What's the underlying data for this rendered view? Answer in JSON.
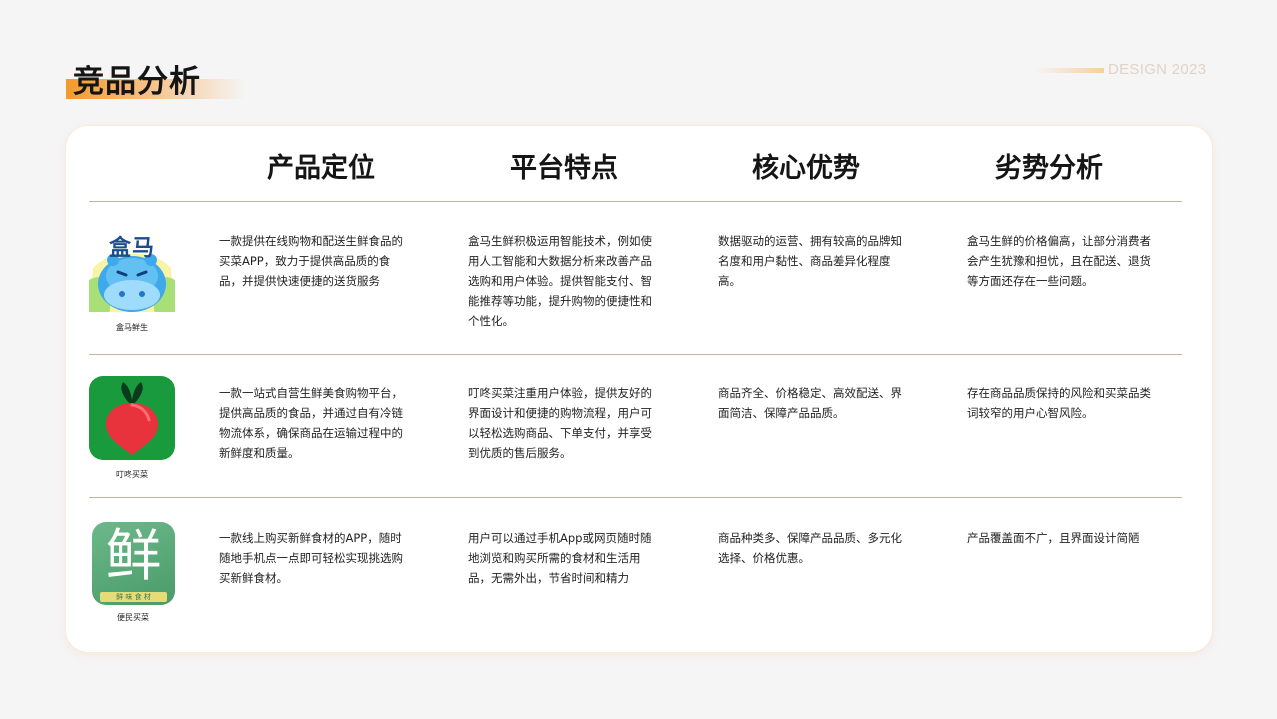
{
  "header": {
    "title": "竞品分析",
    "design_label": "DESIGN 2023"
  },
  "columns": [
    "产品定位",
    "平台特点",
    "核心优势",
    "劣势分析"
  ],
  "rows": [
    {
      "name": "盒马鲜生",
      "logo_text": "盒马",
      "icon": "hippo-icon",
      "positioning": "一款提供在线购物和配送生鲜食品的买菜APP，致力于提供高品质的食品，并提供快速便捷的送货服务",
      "features": "盒马生鲜积极运用智能技术，例如使用人工智能和大数据分析来改善产品选购和用户体验。提供智能支付、智能推荐等功能，提升购物的便捷性和个性化。",
      "advantages": "数据驱动的运营、拥有较高的品牌知名度和用户黏性、商品差异化程度高。",
      "weaknesses": "盒马生鲜的价格偏高，让部分消费者会产生犹豫和担忧，且在配送、退货等方面还存在一些问题。"
    },
    {
      "name": "叮咚买菜",
      "logo_text": "",
      "icon": "radish-icon",
      "positioning": "一款一站式自营生鲜美食购物平台，提供高品质的食品，并通过自有冷链物流体系，确保商品在运输过程中的新鲜度和质量。",
      "features": "叮咚买菜注重用户体验，提供友好的界面设计和便捷的购物流程，用户可以轻松选购商品、下单支付，并享受到优质的售后服务。",
      "advantages": "商品齐全、价格稳定、高效配送、界面简洁、保障产品品质。",
      "weaknesses": "存在商品品质保持的风险和买菜品类词较窄的用户心智风险。"
    },
    {
      "name": "便民买菜",
      "logo_text": "鲜",
      "logo_subtext": "鲜 味 食 材",
      "icon": "fresh-character-icon",
      "positioning": "一款线上购买新鲜食材的APP，随时随地手机点一点即可轻松实现挑选购买新鲜食材。",
      "features": "用户可以通过手机App或网页随时随地浏览和购买所需的食材和生活用品，无需外出，节省时间和精力",
      "advantages": "商品种类多、保障产品品质、多元化选择、价格优惠。",
      "weaknesses": "产品覆盖面不广，且界面设计简陋"
    }
  ],
  "colors": {
    "accent_orange": "#f39a2a",
    "rule": "#c8b3a2",
    "hema_blue": "#1a4d8f",
    "dingdong_green": "#199a3c",
    "bianmin_green": "#5aa978"
  }
}
